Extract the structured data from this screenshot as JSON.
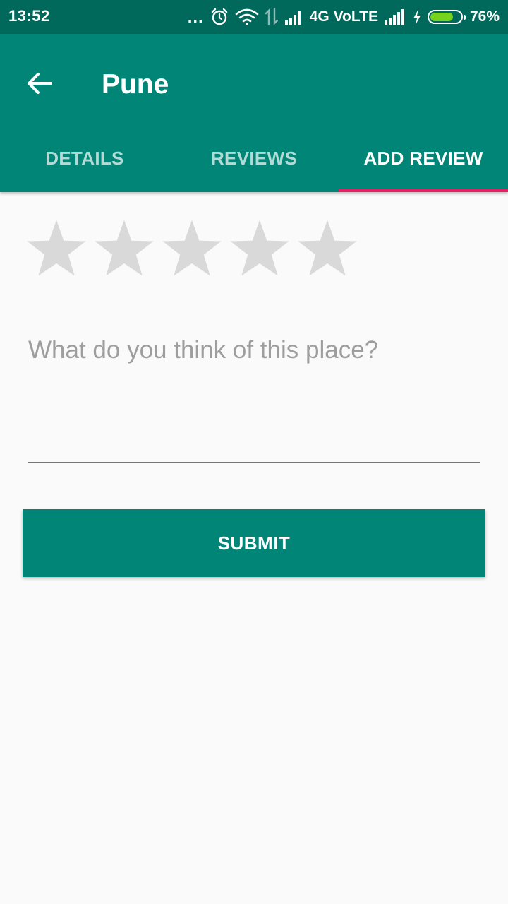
{
  "status_bar": {
    "time": "13:52",
    "dots": "...",
    "network_type": "4G VoLTE",
    "battery_percent": "76%",
    "battery_level": 0.76,
    "battery_color": "#76d21d",
    "icons": [
      "alarm-icon",
      "wifi-icon",
      "data-arrows-icon",
      "signal-icon",
      "signal-icon",
      "charging-icon",
      "battery-icon"
    ]
  },
  "app_bar": {
    "title": "Pune",
    "back_icon": "arrow-back-icon",
    "background_color": "#008577",
    "status_bar_color": "#00695c"
  },
  "tabs": [
    {
      "label": "DETAILS",
      "active": false
    },
    {
      "label": "REVIEWS",
      "active": false
    },
    {
      "label": "ADD REVIEW",
      "active": true
    }
  ],
  "tab_indicator_color": "#e91e63",
  "rating": {
    "max": 5,
    "value": 0,
    "empty_color": "#d9d9d9"
  },
  "review_input": {
    "placeholder": "What do you think of this place?",
    "value": ""
  },
  "submit": {
    "label": "SUBMIT"
  }
}
